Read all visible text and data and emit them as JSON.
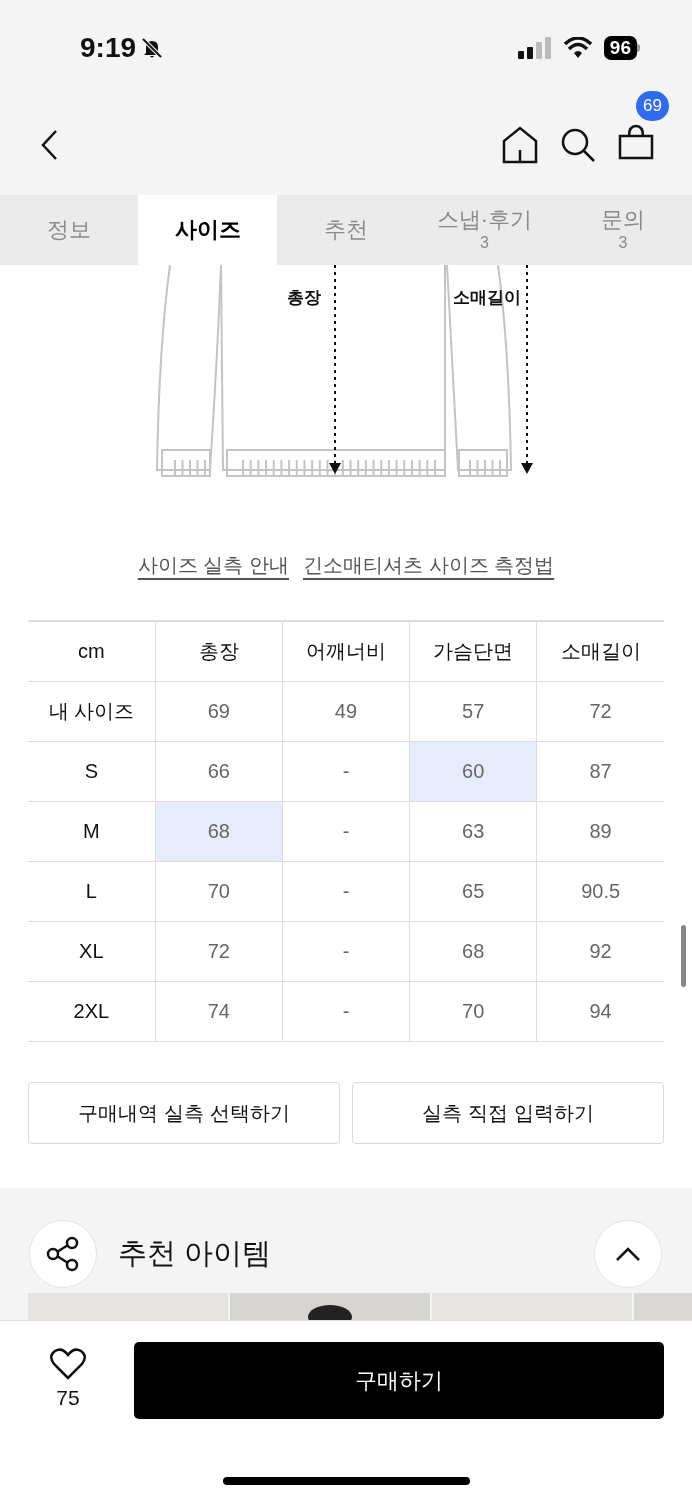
{
  "status_bar": {
    "time": "9:19",
    "battery": "96"
  },
  "header": {
    "cart_count": "69"
  },
  "tabs": [
    {
      "label": "정보",
      "selected": false
    },
    {
      "label": "사이즈",
      "selected": true
    },
    {
      "label": "추천",
      "selected": false
    },
    {
      "label": "스냅·후기",
      "count": "3",
      "selected": false
    },
    {
      "label": "문의",
      "count": "3",
      "selected": false
    }
  ],
  "diagram": {
    "labels": [
      "총장",
      "소매길이"
    ]
  },
  "links": [
    "사이즈 실측 안내",
    "긴소매티셔츠 사이즈 측정법"
  ],
  "size_table": {
    "columns": [
      "cm",
      "총장",
      "어깨너비",
      "가슴단면",
      "소매길이"
    ],
    "rows": [
      {
        "cells": [
          {
            "text": "내 사이즈",
            "selected": false
          },
          {
            "text": "69",
            "selected": false
          },
          {
            "text": "49",
            "selected": false
          },
          {
            "text": "57",
            "selected": false
          },
          {
            "text": "72",
            "selected": false
          }
        ]
      },
      {
        "cells": [
          {
            "text": "S",
            "selected": false
          },
          {
            "text": "66",
            "selected": false
          },
          {
            "text": "-",
            "selected": false
          },
          {
            "text": "60",
            "selected": true
          },
          {
            "text": "87",
            "selected": false
          }
        ]
      },
      {
        "cells": [
          {
            "text": "M",
            "selected": false
          },
          {
            "text": "68",
            "selected": true
          },
          {
            "text": "-",
            "selected": false
          },
          {
            "text": "63",
            "selected": false
          },
          {
            "text": "89",
            "selected": false
          }
        ]
      },
      {
        "cells": [
          {
            "text": "L",
            "selected": false
          },
          {
            "text": "70",
            "selected": false
          },
          {
            "text": "-",
            "selected": false
          },
          {
            "text": "65",
            "selected": false
          },
          {
            "text": "90.5",
            "selected": false
          }
        ]
      },
      {
        "cells": [
          {
            "text": "XL",
            "selected": false
          },
          {
            "text": "72",
            "selected": false
          },
          {
            "text": "-",
            "selected": false
          },
          {
            "text": "68",
            "selected": false
          },
          {
            "text": "92",
            "selected": false
          }
        ]
      },
      {
        "cells": [
          {
            "text": "2XL",
            "selected": false
          },
          {
            "text": "74",
            "selected": false
          },
          {
            "text": "-",
            "selected": false
          },
          {
            "text": "70",
            "selected": false
          },
          {
            "text": "94",
            "selected": false
          }
        ]
      }
    ]
  },
  "actions": [
    "구매내역 실측 선택하기",
    "실측 직접 입력하기"
  ],
  "recommend": {
    "title": "추천 아이템"
  },
  "bottom_bar": {
    "likes": "75",
    "buy": "구매하기"
  }
}
